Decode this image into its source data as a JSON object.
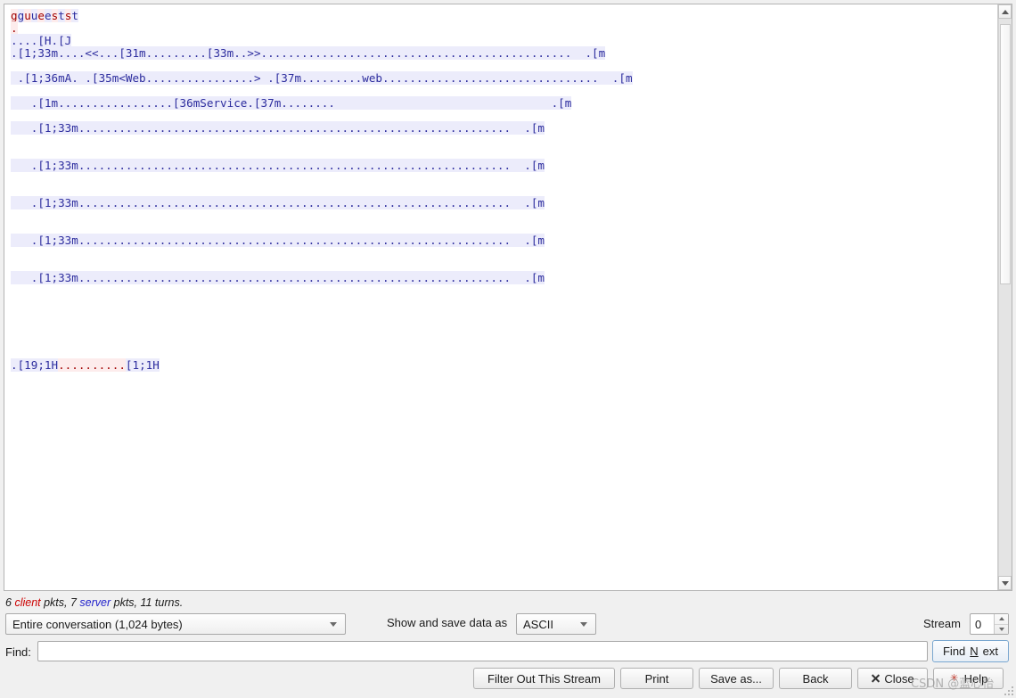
{
  "window": {
    "title": "Follow TCP Stream"
  },
  "stream_pane": {
    "lines": [
      {
        "segments": [
          {
            "side": "client",
            "text": "g"
          },
          {
            "side": "server",
            "text": "g"
          },
          {
            "side": "client",
            "text": "u"
          },
          {
            "side": "server",
            "text": "u"
          },
          {
            "side": "client",
            "text": "e"
          },
          {
            "side": "server",
            "text": "e"
          },
          {
            "side": "client",
            "text": "s"
          },
          {
            "side": "server",
            "text": "t"
          },
          {
            "side": "client",
            "text": "s"
          },
          {
            "side": "server",
            "text": "t"
          }
        ]
      },
      {
        "segments": [
          {
            "side": "client",
            "text": "."
          }
        ]
      },
      {
        "segments": [
          {
            "side": "server",
            "text": "....[H.[J"
          }
        ]
      },
      {
        "segments": [
          {
            "side": "server",
            "text": ".[1;33m....<<...[31m.........[33m..>>..............................................  .[m"
          }
        ]
      },
      {
        "segments": []
      },
      {
        "segments": [
          {
            "side": "server",
            "text": " .[1;36mA. .[35m<Web................> .[37m.........web................................  .[m"
          }
        ]
      },
      {
        "segments": []
      },
      {
        "segments": [
          {
            "side": "server",
            "text": "   .[1m.................[36mService.[37m........                                .[m"
          }
        ]
      },
      {
        "segments": []
      },
      {
        "segments": [
          {
            "side": "server",
            "text": "   .[1;33m................................................................  .[m"
          }
        ]
      },
      {
        "segments": []
      },
      {
        "segments": []
      },
      {
        "segments": [
          {
            "side": "server",
            "text": "   .[1;33m................................................................  .[m"
          }
        ]
      },
      {
        "segments": []
      },
      {
        "segments": []
      },
      {
        "segments": [
          {
            "side": "server",
            "text": "   .[1;33m................................................................  .[m"
          }
        ]
      },
      {
        "segments": []
      },
      {
        "segments": []
      },
      {
        "segments": [
          {
            "side": "server",
            "text": "   .[1;33m................................................................  .[m"
          }
        ]
      },
      {
        "segments": []
      },
      {
        "segments": []
      },
      {
        "segments": [
          {
            "side": "server",
            "text": "   .[1;33m................................................................  .[m"
          }
        ]
      },
      {
        "segments": []
      },
      {
        "segments": []
      },
      {
        "segments": []
      },
      {
        "segments": []
      },
      {
        "segments": []
      },
      {
        "segments": []
      },
      {
        "segments": [
          {
            "side": "server",
            "text": ".[19;1H"
          },
          {
            "side": "client",
            "text": ".........."
          },
          {
            "side": "server",
            "text": "[1;1H"
          }
        ]
      }
    ]
  },
  "status": {
    "client_pkts": "6",
    "client_word": "client",
    "mid_text": " pkts, ",
    "server_pkts": "7",
    "server_word": "server",
    "tail_text": " pkts, 11 turns."
  },
  "controls": {
    "conversation_select": "Entire conversation (1,024 bytes)",
    "show_save_label": "Show and save data as",
    "format_select": "ASCII",
    "stream_label": "Stream",
    "stream_value": "0",
    "find_label": "Find:",
    "find_value": "",
    "find_placeholder": "",
    "find_next_pre": "Find ",
    "find_next_mnemonic": "N",
    "find_next_post": "ext"
  },
  "buttons": {
    "filter_out": "Filter Out This Stream",
    "print": "Print",
    "save_as": "Save as...",
    "back": "Back",
    "close": "Close",
    "help": "Help"
  },
  "watermark": {
    "text": "CSDN @蓝心怡"
  },
  "colors": {
    "client_text": "#a00000",
    "client_bg": "#fdecec",
    "server_text": "#2d2d9e",
    "server_bg": "#ececfb",
    "window_bg": "#f0f0f0",
    "accent": "#7aa7d0"
  }
}
